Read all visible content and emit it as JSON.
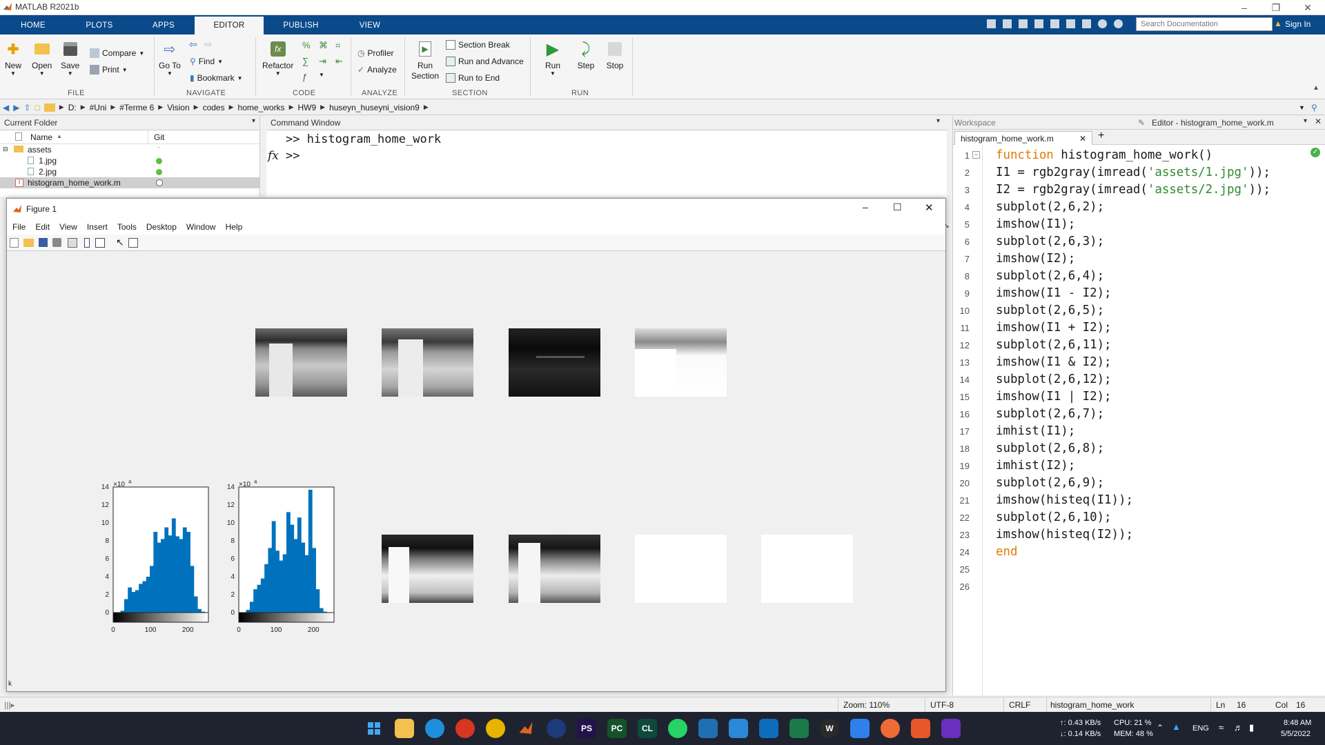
{
  "window": {
    "title": "MATLAB R2021b"
  },
  "tabs": [
    {
      "label": "HOME"
    },
    {
      "label": "PLOTS"
    },
    {
      "label": "APPS"
    },
    {
      "label": "EDITOR"
    },
    {
      "label": "PUBLISH"
    },
    {
      "label": "VIEW"
    }
  ],
  "search": {
    "placeholder": "Search Documentation"
  },
  "signin": "Sign In",
  "ribbon": {
    "file": {
      "group": "FILE",
      "new": "New",
      "open": "Open",
      "save": "Save",
      "compare": "Compare",
      "print": "Print"
    },
    "navigate": {
      "group": "NAVIGATE",
      "goto": "Go To",
      "find": "Find",
      "bookmark": "Bookmark"
    },
    "code": {
      "group": "CODE",
      "refactor": "Refactor",
      "fx": "fx"
    },
    "analyze": {
      "group": "ANALYZE",
      "profiler": "Profiler",
      "analyze": "Analyze"
    },
    "section": {
      "group": "SECTION",
      "run_section": "Run Section",
      "section_break": "Section Break",
      "run_advance": "Run and Advance",
      "run_end": "Run to End"
    },
    "run": {
      "group": "RUN",
      "run": "Run",
      "step": "Step",
      "stop": "Stop"
    }
  },
  "path": [
    "D:",
    "#Uni",
    "#Terme 6",
    "Vision",
    "codes",
    "home_works",
    "HW9",
    "huseyn_huseyni_vision9"
  ],
  "current_folder": {
    "title": "Current Folder",
    "col_name": "Name",
    "col_git": "Git",
    "items": [
      {
        "name": "assets",
        "git": "·"
      },
      {
        "name": "1.jpg",
        "git": ""
      },
      {
        "name": "2.jpg",
        "git": ""
      },
      {
        "name": "histogram_home_work.m",
        "git": ""
      }
    ]
  },
  "command_window": {
    "title": "Command Window",
    "line1": ">> histogram_home_work",
    "prompt": ">>",
    "fx": "fx"
  },
  "workspace": {
    "title": "Workspace"
  },
  "editor": {
    "title": "Editor - histogram_home_work.m",
    "tab": "histogram_home_work.m",
    "plus": "+",
    "lines": [
      {
        "n": "1",
        "kw": "function",
        "rest": " histogram_home_work()",
        "str": "",
        "tail": ""
      },
      {
        "n": "2",
        "kw": "",
        "rest": "I1 = rgb2gray(imread(",
        "str": "'assets/1.jpg'",
        "tail": "));"
      },
      {
        "n": "3",
        "kw": "",
        "rest": "I2 = rgb2gray(imread(",
        "str": "'assets/2.jpg'",
        "tail": "));"
      },
      {
        "n": "4",
        "kw": "",
        "rest": "subplot(2,6,2);",
        "str": "",
        "tail": ""
      },
      {
        "n": "5",
        "kw": "",
        "rest": "imshow(I1);",
        "str": "",
        "tail": ""
      },
      {
        "n": "6",
        "kw": "",
        "rest": "subplot(2,6,3);",
        "str": "",
        "tail": ""
      },
      {
        "n": "7",
        "kw": "",
        "rest": "imshow(I2);",
        "str": "",
        "tail": ""
      },
      {
        "n": "8",
        "kw": "",
        "rest": "subplot(2,6,4);",
        "str": "",
        "tail": ""
      },
      {
        "n": "9",
        "kw": "",
        "rest": "imshow(I1 - I2);",
        "str": "",
        "tail": ""
      },
      {
        "n": "10",
        "kw": "",
        "rest": "subplot(2,6,5);",
        "str": "",
        "tail": ""
      },
      {
        "n": "11",
        "kw": "",
        "rest": "imshow(I1 + I2);",
        "str": "",
        "tail": ""
      },
      {
        "n": "12",
        "kw": "",
        "rest": "subplot(2,6,11);",
        "str": "",
        "tail": ""
      },
      {
        "n": "13",
        "kw": "",
        "rest": "imshow(I1 & I2);",
        "str": "",
        "tail": ""
      },
      {
        "n": "14",
        "kw": "",
        "rest": "subplot(2,6,12);",
        "str": "",
        "tail": ""
      },
      {
        "n": "15",
        "kw": "",
        "rest": "imshow(I1 | I2);",
        "str": "",
        "tail": ""
      },
      {
        "n": "16",
        "kw": "",
        "rest": "subplot(2,6,7);",
        "str": "",
        "tail": ""
      },
      {
        "n": "17",
        "kw": "",
        "rest": "imhist(I1);",
        "str": "",
        "tail": ""
      },
      {
        "n": "18",
        "kw": "",
        "rest": "subplot(2,6,8);",
        "str": "",
        "tail": ""
      },
      {
        "n": "19",
        "kw": "",
        "rest": "imhist(I2);",
        "str": "",
        "tail": ""
      },
      {
        "n": "20",
        "kw": "",
        "rest": "subplot(2,6,9);",
        "str": "",
        "tail": ""
      },
      {
        "n": "21",
        "kw": "",
        "rest": "imshow(histeq(I1));",
        "str": "",
        "tail": ""
      },
      {
        "n": "22",
        "kw": "",
        "rest": "subplot(2,6,10);",
        "str": "",
        "tail": ""
      },
      {
        "n": "23",
        "kw": "",
        "rest": "imshow(histeq(I2));",
        "str": "",
        "tail": ""
      },
      {
        "n": "24",
        "kw": "end",
        "rest": "",
        "str": "",
        "tail": ""
      },
      {
        "n": "25",
        "kw": "",
        "rest": "",
        "str": "",
        "tail": ""
      },
      {
        "n": "26",
        "kw": "",
        "rest": "",
        "str": "",
        "tail": ""
      }
    ]
  },
  "figure": {
    "title": "Figure 1",
    "menu": [
      "File",
      "Edit",
      "View",
      "Insert",
      "Tools",
      "Desktop",
      "Window",
      "Help"
    ],
    "hist_exponent": "×10",
    "hist_exponent_power": "4",
    "hist_yticks": [
      "14",
      "12",
      "10",
      "8",
      "6",
      "4",
      "2",
      "0"
    ],
    "hist_xticks": [
      "0",
      "100",
      "200"
    ]
  },
  "status": {
    "zoom": "Zoom: 110%",
    "encoding": "UTF-8",
    "eol": "CRLF",
    "function": "histogram_home_work",
    "ln_label": "Ln",
    "ln": "16",
    "col_label": "Col",
    "col": "16"
  },
  "taskbar": {
    "net_up": "↑: 0.43 KB/s",
    "net_down": "↓: 0.14 KB/s",
    "cpu": "CPU: 21 %",
    "mem": "MEM: 48 %",
    "lang": "ENG",
    "time": "8:48 AM",
    "date": "5/5/2022"
  },
  "chart_data": [
    {
      "type": "bar",
      "title": "",
      "xlabel": "",
      "ylabel": "",
      "xlim": [
        0,
        255
      ],
      "ylim": [
        0,
        14
      ],
      "y_scale_label": "×10^4",
      "x": [
        0,
        10,
        20,
        30,
        40,
        50,
        60,
        70,
        80,
        90,
        100,
        110,
        120,
        130,
        140,
        150,
        160,
        170,
        180,
        190,
        200,
        210,
        220,
        230,
        240,
        250
      ],
      "values": [
        0,
        0,
        0.2,
        1.5,
        2.8,
        2.3,
        2.5,
        3.2,
        3.5,
        4.0,
        5.2,
        9.0,
        7.8,
        8.2,
        9.5,
        8.6,
        10.5,
        8.5,
        8.2,
        9.5,
        9.0,
        5.2,
        1.8,
        0.4,
        0.1,
        0
      ]
    },
    {
      "type": "bar",
      "title": "",
      "xlabel": "",
      "ylabel": "",
      "xlim": [
        0,
        255
      ],
      "ylim": [
        0,
        14
      ],
      "y_scale_label": "×10^4",
      "x": [
        0,
        10,
        20,
        30,
        40,
        50,
        60,
        70,
        80,
        90,
        100,
        110,
        120,
        130,
        140,
        150,
        160,
        170,
        180,
        190,
        200,
        210,
        220,
        230,
        240,
        250
      ],
      "values": [
        0,
        0,
        0.3,
        1.2,
        2.6,
        3.1,
        3.8,
        5.4,
        7.2,
        10.2,
        6.9,
        5.8,
        6.5,
        11.2,
        9.8,
        8.2,
        10.6,
        7.8,
        6.4,
        13.7,
        7.2,
        2.6,
        0.5,
        0.1,
        0,
        0
      ]
    }
  ]
}
